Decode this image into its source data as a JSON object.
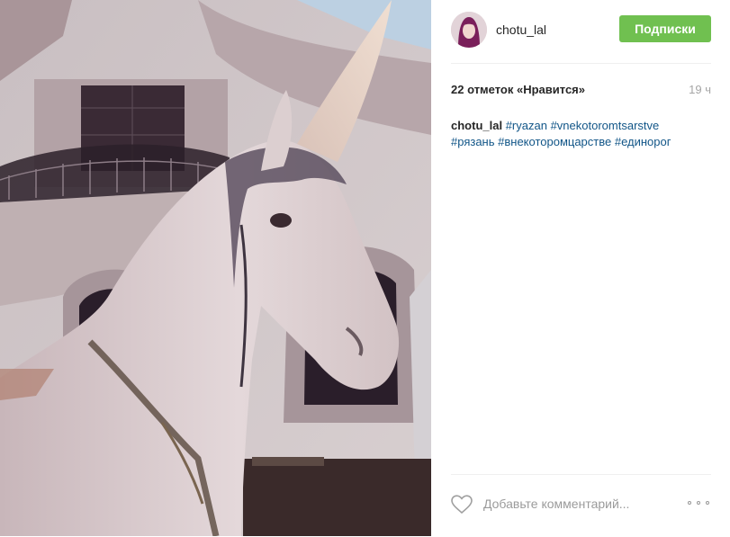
{
  "post": {
    "image_alt": "Statue of a white unicorn in front of a building",
    "username": "chotu_lal",
    "follow_label": "Подписки",
    "likes": "22 отметок «Нравится»",
    "time_ago": "19 ч",
    "caption": {
      "user": "chotu_lal",
      "tags": [
        "#ryazan",
        "#vnekotoromtsarstve",
        "#рязань",
        "#внекоторомцарстве",
        "#единорог"
      ]
    },
    "comment_placeholder": "Добавьте комментарий...",
    "icons": [
      "heart-icon",
      "more-options-icon"
    ]
  },
  "colors": {
    "follow_button": "#70c050",
    "hashtag": "#125688",
    "muted_text": "#a5a5a5"
  }
}
